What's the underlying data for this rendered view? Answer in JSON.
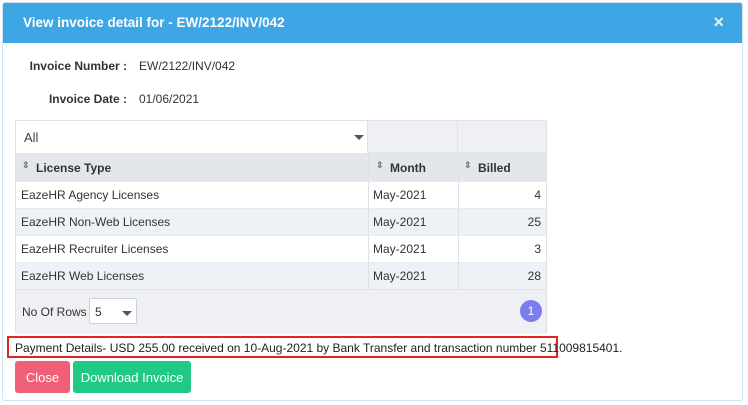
{
  "modal": {
    "title": "View invoice detail for - EW/2122/INV/042",
    "close_glyph": "×"
  },
  "invoice": {
    "number_label": "Invoice Number :",
    "number_value": "EW/2122/INV/042",
    "date_label": "Invoice Date :",
    "date_value": "01/06/2021"
  },
  "table": {
    "filter_value": "All",
    "sort_glyph": "⇕",
    "columns": [
      "License Type",
      "Month",
      "Billed"
    ],
    "rows": [
      [
        "EazeHR Agency Licenses",
        "May-2021",
        "4"
      ],
      [
        "EazeHR Non-Web Licenses",
        "May-2021",
        "25"
      ],
      [
        "EazeHR Recruiter Licenses",
        "May-2021",
        "3"
      ],
      [
        "EazeHR Web Licenses",
        "May-2021",
        "28"
      ]
    ],
    "rows_label": "No Of Rows :",
    "rows_value": "5",
    "current_page": "1"
  },
  "payment": {
    "details": "Payment Details- USD 255.00 received on 10-Aug-2021 by Bank Transfer and transaction number 511009815401."
  },
  "buttons": {
    "close": "Close",
    "download": "Download Invoice"
  },
  "colors": {
    "header": "#3fa6e6",
    "close_button": "#ef5f77",
    "download_button": "#21c987",
    "page_button": "#7b7cf0",
    "highlight_border": "#e02424"
  }
}
